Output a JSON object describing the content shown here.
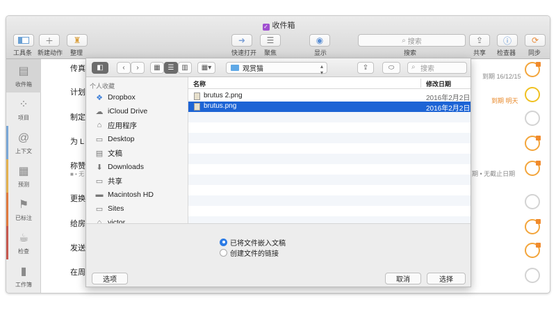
{
  "window": {
    "title": "收件箱"
  },
  "toolbar": {
    "items": [
      {
        "label": "工具条"
      },
      {
        "label": "新建动作"
      },
      {
        "label": "整理"
      },
      {
        "label": "快速打开"
      },
      {
        "label": "聚焦"
      },
      {
        "label": "显示"
      },
      {
        "label": "搜索"
      },
      {
        "label": "共享"
      },
      {
        "label": "检查器"
      },
      {
        "label": "同步"
      }
    ],
    "search_placeholder": "搜索"
  },
  "sidebar": {
    "items": [
      {
        "label": "收件箱",
        "icon": "inbox-icon",
        "active": true
      },
      {
        "label": "项目",
        "icon": "projects-icon"
      },
      {
        "label": "上下文",
        "icon": "context-icon"
      },
      {
        "label": "预测",
        "icon": "forecast-icon"
      },
      {
        "label": "已标注",
        "icon": "flag-icon"
      },
      {
        "label": "检查",
        "icon": "review-icon"
      },
      {
        "label": "工作簿",
        "icon": "workbook-icon"
      }
    ],
    "colors": {
      "context": "#7aa7d6",
      "forecast": "#e3b24f",
      "flagged": "#e07a3e",
      "review": "#c6584f"
    }
  },
  "list": {
    "rows": [
      "传真",
      "计划",
      "制定",
      "为 L",
      "称赞",
      "更换",
      "给房",
      "发送",
      "在周"
    ],
    "due_label_1": "到期 16/12/15",
    "due_label_2": "到期 明天",
    "due_label_3": "期 • 无截止日期",
    "sub_mark": "■ • 无"
  },
  "dialog": {
    "location": "观赏猫",
    "search_placeholder": "搜索",
    "sidebar_section": "个人收藏",
    "favorites": [
      {
        "label": "Dropbox",
        "icon": "dropbox-icon"
      },
      {
        "label": "iCloud Drive",
        "icon": "cloud-icon"
      },
      {
        "label": "应用程序",
        "icon": "applications-icon"
      },
      {
        "label": "Desktop",
        "icon": "desktop-icon"
      },
      {
        "label": "文稿",
        "icon": "documents-icon"
      },
      {
        "label": "Downloads",
        "icon": "downloads-icon"
      },
      {
        "label": "共享",
        "icon": "shared-folder-icon"
      },
      {
        "label": "Macintosh HD",
        "icon": "hard-drive-icon"
      },
      {
        "label": "Sites",
        "icon": "folder-icon"
      },
      {
        "label": "victor",
        "icon": "home-icon"
      }
    ],
    "columns": {
      "name": "名称",
      "modified": "修改日期"
    },
    "files": [
      {
        "name": "brutus 2.png",
        "date": "2016年2月2日",
        "selected": false
      },
      {
        "name": "brutus.png",
        "date": "2016年2月2日",
        "selected": true
      }
    ],
    "options": {
      "embed_label": "已将文件嵌入文稿",
      "link_label": "创建文件的链接",
      "selected": "embed"
    },
    "buttons": {
      "options": "选项",
      "cancel": "取消",
      "choose": "选择"
    }
  }
}
